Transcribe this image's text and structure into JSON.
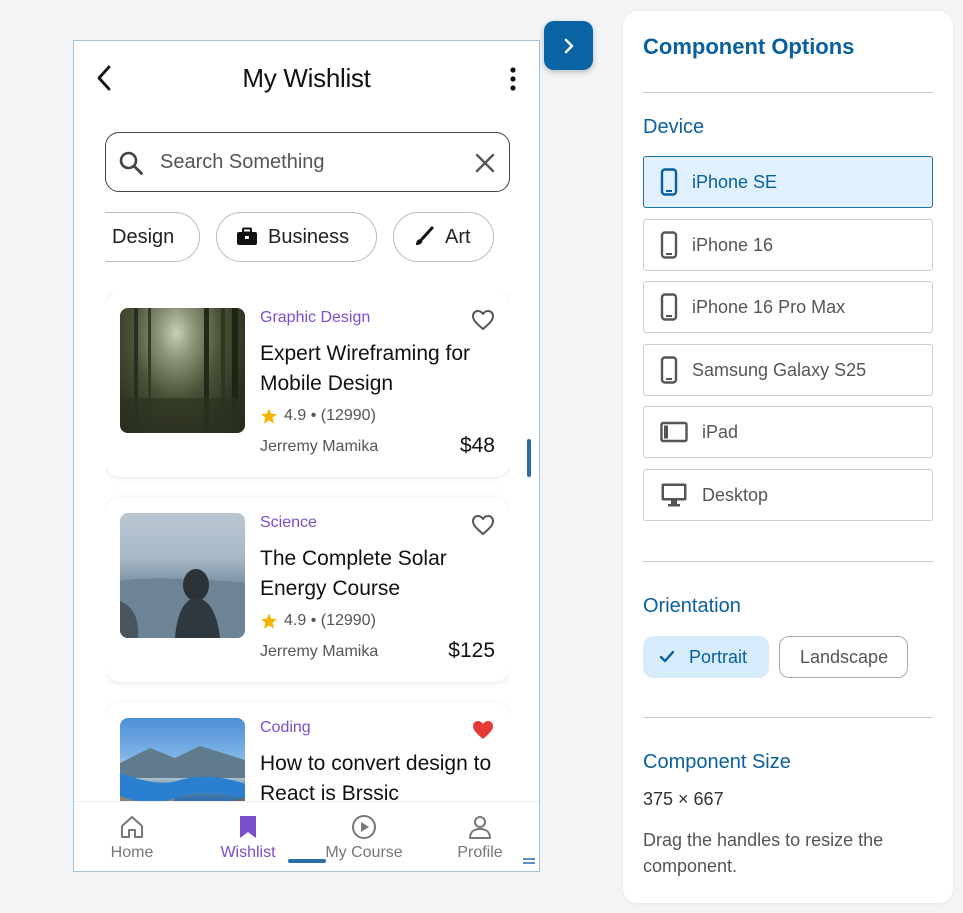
{
  "phone": {
    "title": "My Wishlist",
    "search": {
      "placeholder": "Search Something"
    },
    "chips": [
      {
        "label": "Design",
        "icon": "none"
      },
      {
        "label": "Business",
        "icon": "briefcase-icon"
      },
      {
        "label": "Art",
        "icon": "brush-icon"
      }
    ],
    "courses": [
      {
        "category": "Graphic Design",
        "title": "Expert Wireframing for Mobile Design",
        "rating": "4.9",
        "reviews": "(12990)",
        "author": "Jerremy Mamika",
        "price": "$48",
        "favorite": false
      },
      {
        "category": "Science",
        "title": "The Complete Solar Energy Course",
        "rating": "4.9",
        "reviews": "(12990)",
        "author": "Jerremy Mamika",
        "price": "$125",
        "favorite": false
      },
      {
        "category": "Coding",
        "title": "How to convert design to React is Brssic",
        "rating": "",
        "reviews": "",
        "author": "",
        "price": "",
        "favorite": true
      }
    ],
    "tabs": [
      {
        "label": "Home",
        "icon": "home-icon",
        "active": false
      },
      {
        "label": "Wishlist",
        "icon": "bookmark-icon",
        "active": true
      },
      {
        "label": "My Course",
        "icon": "play-circle-icon",
        "active": false
      },
      {
        "label": "Profile",
        "icon": "person-icon",
        "active": false
      }
    ]
  },
  "panel": {
    "title": "Component Options",
    "device_label": "Device",
    "devices": [
      {
        "label": "iPhone SE",
        "icon": "phone-icon",
        "selected": true
      },
      {
        "label": "iPhone 16",
        "icon": "phone-icon",
        "selected": false
      },
      {
        "label": "iPhone 16 Pro Max",
        "icon": "phone-icon",
        "selected": false
      },
      {
        "label": "Samsung Galaxy S25",
        "icon": "phone-icon",
        "selected": false
      },
      {
        "label": "iPad",
        "icon": "tablet-icon",
        "selected": false
      },
      {
        "label": "Desktop",
        "icon": "monitor-icon",
        "selected": false
      }
    ],
    "orientation_label": "Orientation",
    "orientations": {
      "portrait": "Portrait",
      "landscape": "Landscape"
    },
    "size_label": "Component Size",
    "size_value": "375 × 667",
    "size_help": "Drag the handles to resize the component."
  },
  "colors": {
    "accent": "#0a5f9e",
    "category": "#7c4dcb",
    "heart_active": "#e53935",
    "star": "#f5b400"
  }
}
